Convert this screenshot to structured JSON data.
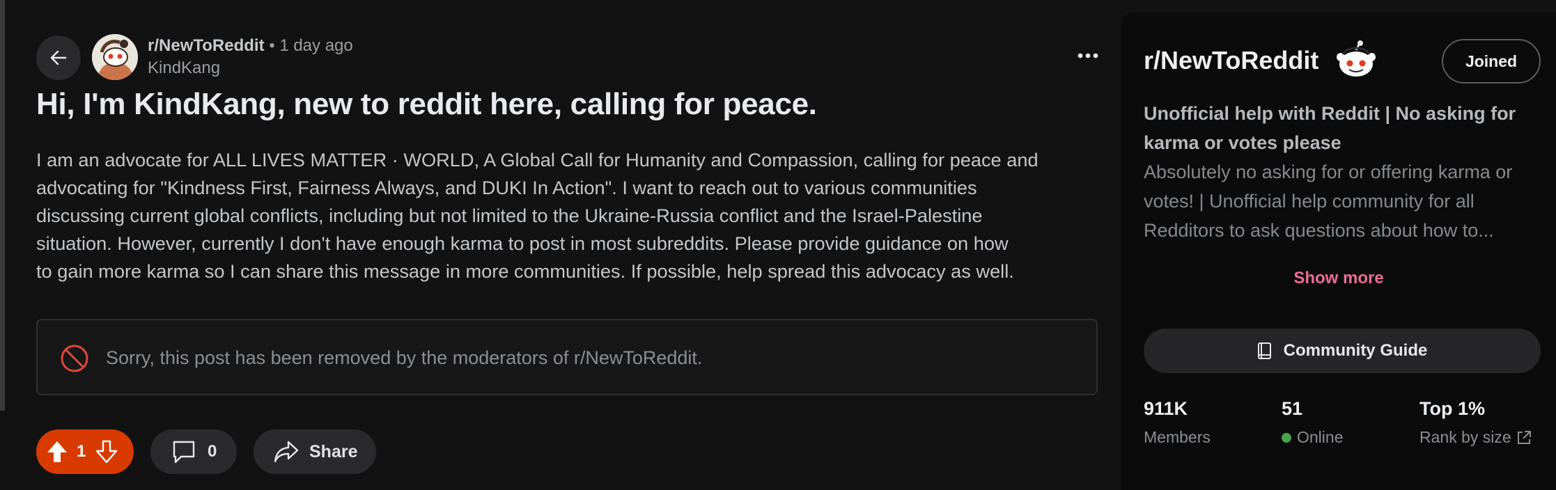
{
  "post": {
    "subreddit": "r/NewToReddit",
    "separator": "•",
    "time_ago": "1 day ago",
    "author": "KindKang",
    "title": "Hi, I'm KindKang, new to reddit here, calling for peace.",
    "body_lines": [
      "I am an advocate for ALL LIVES MATTER · WORLD, A Global Call for Humanity and Compassion, calling for peace and",
      "advocating for \"Kindness First, Fairness Always, and DUKI In Action\". I want to reach out to various communities",
      "discussing current global conflicts, including but not limited to the Ukraine-Russia conflict and the Israel-Palestine",
      "situation. However, currently I don't have enough karma to post in most subreddits. Please provide guidance on how",
      "to gain more karma so I can share this message in more communities. If possible, help spread this advocacy as well."
    ],
    "removed_notice": "Sorry, this post has been removed by the moderators of r/NewToReddit.",
    "score": "1",
    "comment_count": "0",
    "share_label": "Share"
  },
  "sidebar": {
    "community_name": "r/NewToReddit",
    "joined_label": "Joined",
    "heading": "Unofficial help with Reddit | No asking for karma or votes please",
    "description": "Absolutely no asking for or offering karma or votes! | Unofficial help community for all Redditors to ask questions about how to...",
    "show_more_label": "Show more",
    "guide_label": "Community Guide",
    "stats": {
      "members_value": "911K",
      "members_label": "Members",
      "online_value": "51",
      "online_label": "Online",
      "rank_value": "Top 1%",
      "rank_label": "Rank by size"
    }
  },
  "colors": {
    "upvote_active": "#d93a00",
    "show_more": "#ec6c98",
    "online_dot": "#47a34f",
    "removed_icon": "#e0473a"
  },
  "icons": [
    "back-arrow-icon",
    "more-options-icon",
    "ban-icon",
    "upvote-icon",
    "downvote-icon",
    "comment-icon",
    "share-icon",
    "snoo-icon",
    "book-icon",
    "external-link-icon"
  ]
}
